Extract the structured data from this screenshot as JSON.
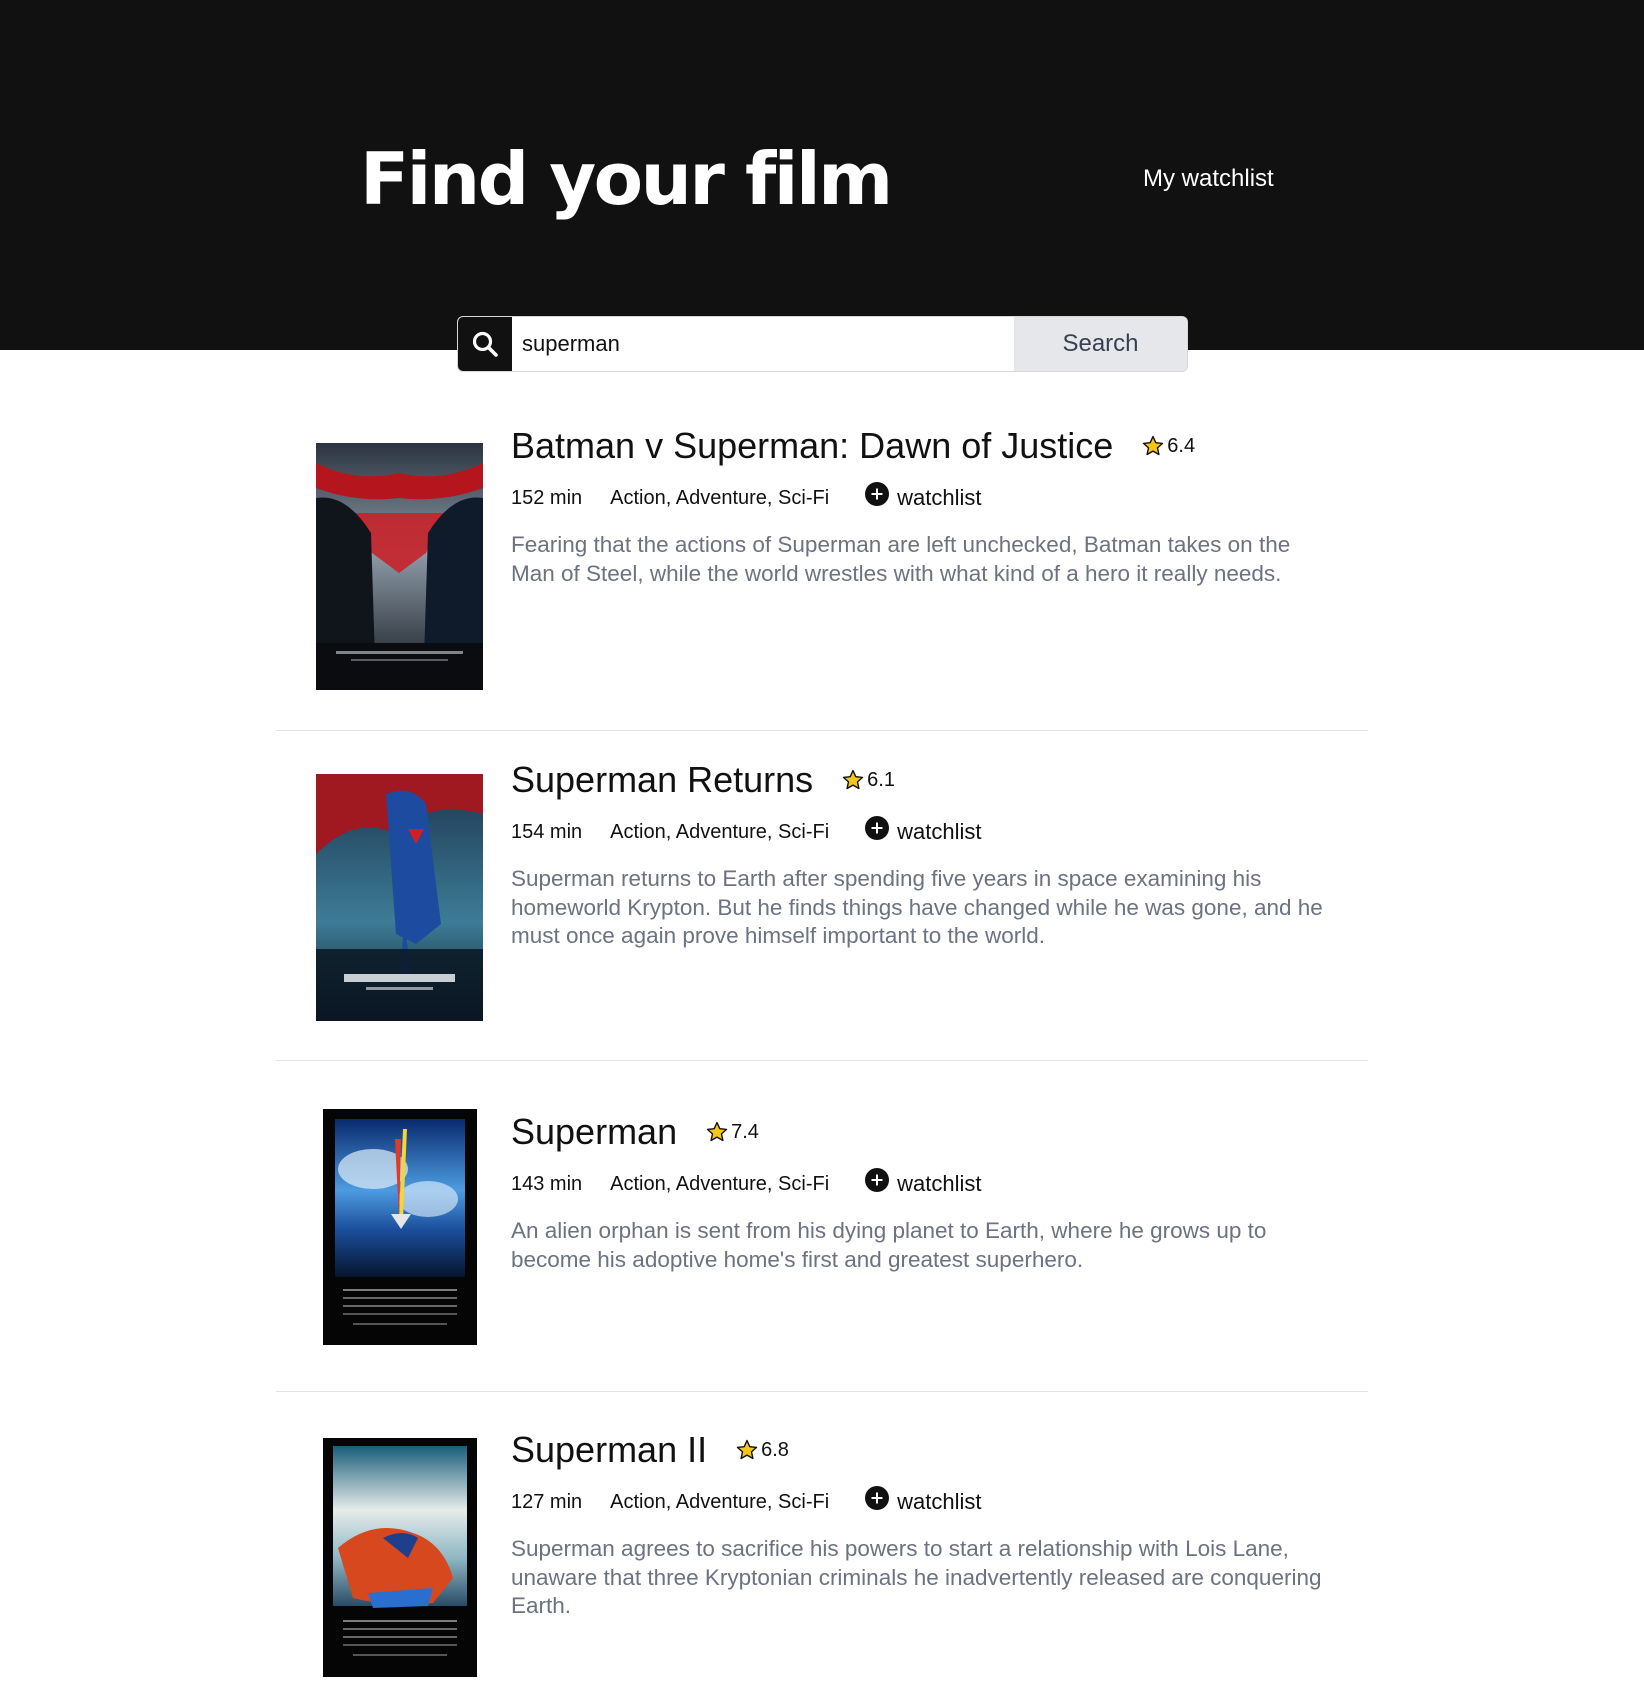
{
  "header": {
    "title": "Find your film",
    "watchlist_link": "My watchlist"
  },
  "search": {
    "value": "superman",
    "placeholder": "",
    "button_label": "Search"
  },
  "movies": [
    {
      "title": "Batman v Superman: Dawn of Justice",
      "rating": "6.4",
      "runtime": "152 min",
      "genres": "Action, Adventure, Sci-Fi",
      "watchlist_label": "watchlist",
      "plot": "Fearing that the actions of Superman are left unchecked, Batman takes on the Man of Steel, while the world wrestles with what kind of a hero it really needs."
    },
    {
      "title": "Superman Returns",
      "rating": "6.1",
      "runtime": "154 min",
      "genres": "Action, Adventure, Sci-Fi",
      "watchlist_label": "watchlist",
      "plot": "Superman returns to Earth after spending five years in space examining his homeworld Krypton. But he finds things have changed while he was gone, and he must once again prove himself important to the world."
    },
    {
      "title": "Superman",
      "rating": "7.4",
      "runtime": "143 min",
      "genres": "Action, Adventure, Sci-Fi",
      "watchlist_label": "watchlist",
      "plot": "An alien orphan is sent from his dying planet to Earth, where he grows up to become his adoptive home's first and greatest superhero."
    },
    {
      "title": "Superman II",
      "rating": "6.8",
      "runtime": "127 min",
      "genres": "Action, Adventure, Sci-Fi",
      "watchlist_label": "watchlist",
      "plot": "Superman agrees to sacrifice his powers to start a relationship with Lois Lane, unaware that three Kryptonian criminals he inadvertently released are conquering Earth."
    }
  ],
  "icons": {
    "search": "search-icon",
    "star": "star-icon",
    "add": "plus-circle-icon"
  },
  "colors": {
    "header_bg": "#111111",
    "search_button_bg": "#e5e7eb",
    "star_fill": "#f5c518",
    "plot_text": "#6b7280"
  }
}
